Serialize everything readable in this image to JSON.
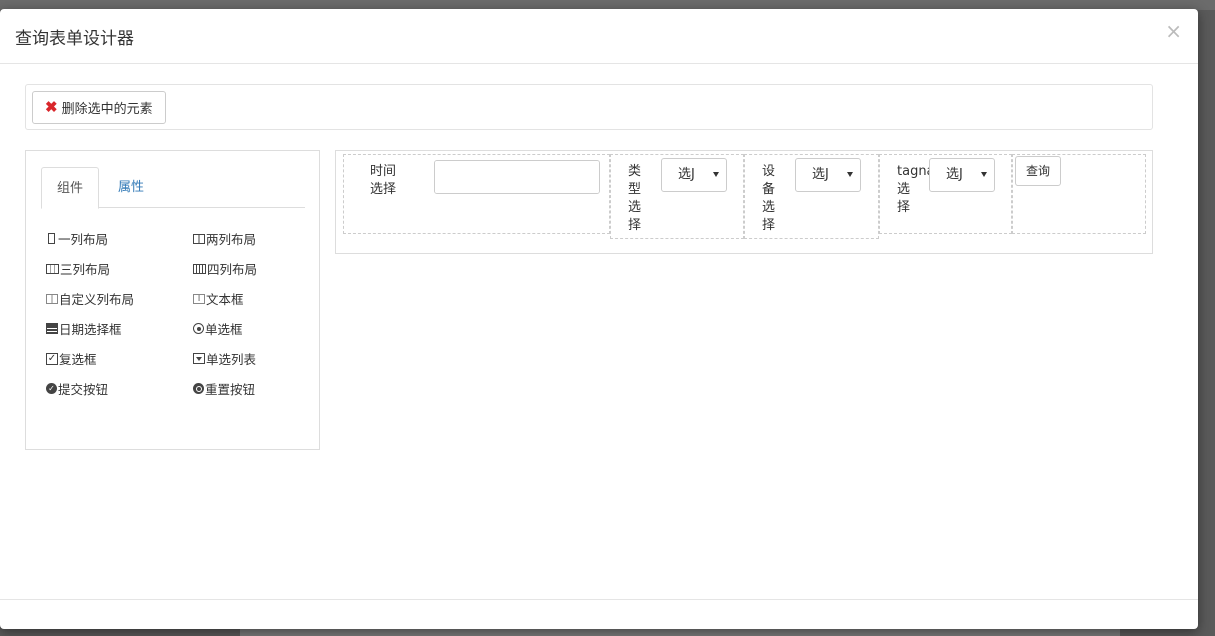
{
  "modal": {
    "title": "查询表单设计器",
    "close": "×"
  },
  "toolbar": {
    "delete_label": "删除选中的元素",
    "delete_icon": "x-icon"
  },
  "tabs": [
    {
      "label": "组件"
    },
    {
      "label": "属性"
    }
  ],
  "components": [
    {
      "label": "一列布局",
      "icon": "one-column-icon"
    },
    {
      "label": "两列布局",
      "icon": "two-column-icon"
    },
    {
      "label": "三列布局",
      "icon": "three-column-icon"
    },
    {
      "label": "四列布局",
      "icon": "four-column-icon"
    },
    {
      "label": "自定义列布局",
      "icon": "custom-column-icon"
    },
    {
      "label": "文本框",
      "icon": "textbox-icon"
    },
    {
      "label": "日期选择框",
      "icon": "calendar-icon"
    },
    {
      "label": "单选框",
      "icon": "radio-icon"
    },
    {
      "label": "复选框",
      "icon": "checkbox-icon"
    },
    {
      "label": "单选列表",
      "icon": "select-icon"
    },
    {
      "label": "提交按钮",
      "icon": "submit-icon"
    },
    {
      "label": "重置按钮",
      "icon": "reset-icon"
    }
  ],
  "form": {
    "time_label": "时间\n选择",
    "date_value": "",
    "type_label": "类\n型\n选\n择",
    "type_select": "选J",
    "device_label": "设\n备\n选\n择",
    "device_select": "选J",
    "tagname_label": "tagna\n选\n择",
    "tagname_select": "选J",
    "query_label": "查询"
  }
}
